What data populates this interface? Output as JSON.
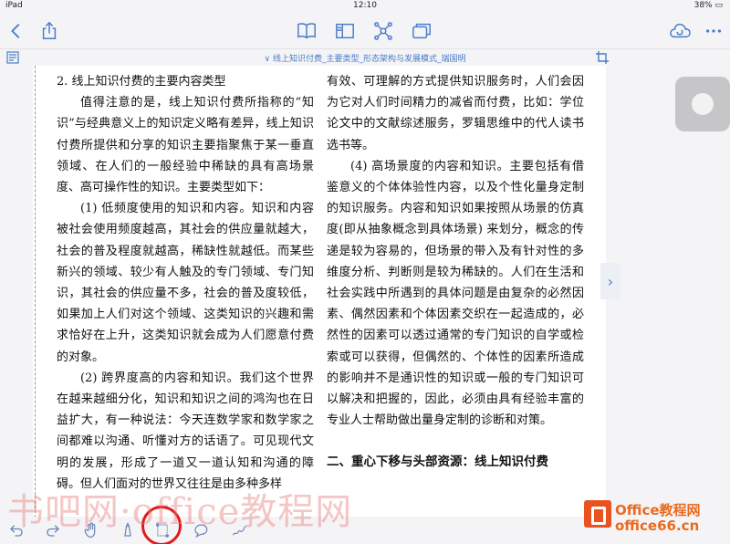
{
  "status_bar": {
    "carrier": "iPad",
    "time": "12:10",
    "battery": "38%"
  },
  "toolbar": {
    "buttons": [
      "back-icon",
      "share-icon",
      "book-icon",
      "layout-icon",
      "mindmap-icon",
      "pages-icon",
      "cloud-icon",
      "more-icon"
    ]
  },
  "document": {
    "breadcrumb": "线上知识付费_主要类型_形态架构与发展模式_瑞国明"
  },
  "page": {
    "left_col": [
      {
        "style": "plain",
        "text": "2. 线上知识付费的主要内容类型"
      },
      {
        "style": "indent",
        "text": "值得注意的是，线上知识付费所指称的“知识”与经典意义上的知识定义略有差异，线上知识付费所提供和分享的知识主要指聚焦于某一垂直领域、在人们的一般经验中稀缺的具有高场景度、高可操作性的知识。主要类型如下："
      },
      {
        "style": "indent",
        "text": "(1) 低频度使用的知识和内容。知识和内容被社会使用频度越高，其社会的供应量就越大，社会的普及程度就越高，稀缺性就越低。而某些新兴的领域、较少有人触及的专门领域、专门知识，其社会的供应量不多，社会的普及度较低，如果加上人们对这个领域、这类知识的兴趣和需求恰好在上升，这类知识就会成为人们愿意付费的对象。"
      },
      {
        "style": "indent",
        "text": "(2) 跨界度高的内容和知识。我们这个世界在越来越细分化，知识和知识之间的鸿沟也在日益扩大，有一种说法：今天连数学家和数学家之间都难以沟通、听懂对方的话语了。可见现代文明的发展，形成了一道又一道认知和沟通的障碍。但人们面对的世界又往往是由多种多样"
      }
    ],
    "right_col": [
      {
        "style": "plain",
        "text": "有效、可理解的方式提供知识服务时，人们会因为它对人们时间精力的减省而付费，比如：学位论文中的文献综述服务，罗辑思维中的代人读书选书等。"
      },
      {
        "style": "indent",
        "text": "(4) 高场景度的内容和知识。主要包括有借鉴意义的个体体验性内容，以及个性化量身定制的知识服务。内容和知识如果按照从场景的仿真度(即从抽象概念到具体场景) 来划分，概念的传递是较为容易的，但场景的带入及有针对性的多维度分析、判断则是较为稀缺的。人们在生活和社会实践中所遇到的具体问题是由复杂的必然因素、偶然因素和个体因素交织在一起造成的，必然性的因素可以透过通常的专门知识的自学或检索或可以获得，但偶然的、个体性的因素所造成的影响并不是通识性的知识或一般的专门知识可以解决和把握的，因此，必须由具有经验丰富的专业人士帮助做出量身定制的诊断和对策。"
      },
      {
        "style": "gap",
        "text": ""
      },
      {
        "style": "bold",
        "text": "二、重心下移与头部资源：线上知识付费"
      }
    ]
  },
  "bottom_bar": {
    "tools": [
      "undo-icon",
      "redo-icon",
      "hand-icon",
      "highlighter-icon",
      "lasso-select-icon",
      "comment-icon",
      "pen-icon"
    ]
  },
  "watermark": {
    "left_text": "书吧网·office教程网",
    "brand_line1": "Office教程网",
    "brand_line2": "office66.cn"
  }
}
